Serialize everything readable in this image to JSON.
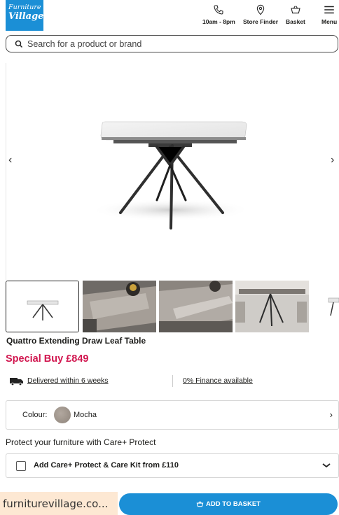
{
  "header": {
    "logo_line1": "Furniture",
    "logo_line2": "Village",
    "phone_label": "10am - 8pm",
    "store_label": "Store Finder",
    "basket_label": "Basket",
    "menu_label": "Menu"
  },
  "search": {
    "placeholder": "Search for a product or brand"
  },
  "product": {
    "title": "Quattro Extending Draw Leaf Table",
    "price": "Special Buy £849",
    "delivery": "Delivered within 6 weeks",
    "finance": "0% Finance available",
    "colour_label": "Colour:",
    "colour_value": "Mocha",
    "protect_heading": "Protect your furniture with Care+ Protect",
    "care_option": "Add Care+ Protect & Care Kit from £110",
    "add_to_basket": "ADD TO BASKET"
  },
  "browser": {
    "url": "furniturevillage.co..."
  },
  "colors": {
    "brand": "#1b8fd6",
    "price": "#d1164f"
  }
}
